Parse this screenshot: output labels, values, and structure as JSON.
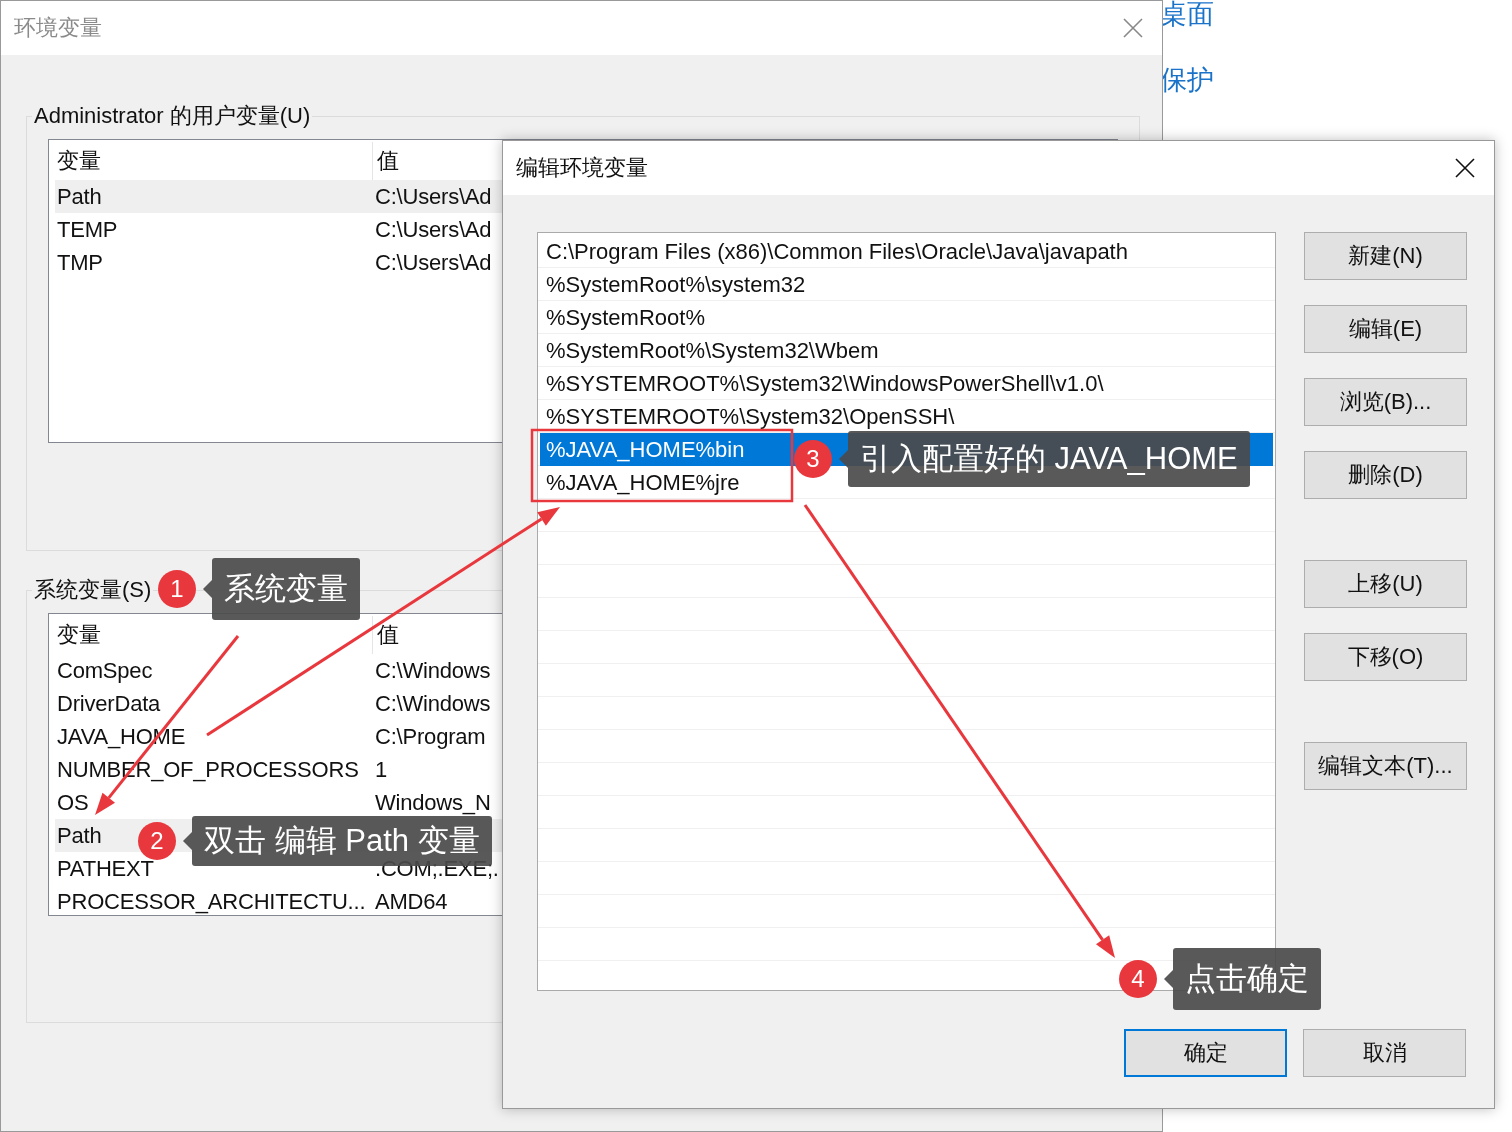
{
  "background_links": [
    "桌面",
    "保护"
  ],
  "env_window": {
    "title": "环境变量",
    "user_group": {
      "label": "Administrator 的用户变量(U)",
      "columns": [
        "变量",
        "值"
      ],
      "rows": [
        {
          "name": "Path",
          "value": "C:\\Users\\Ad",
          "selected": true
        },
        {
          "name": "TEMP",
          "value": "C:\\Users\\Ad",
          "selected": false
        },
        {
          "name": "TMP",
          "value": "C:\\Users\\Ad",
          "selected": false
        }
      ]
    },
    "system_group": {
      "label": "系统变量(S)",
      "columns": [
        "变量",
        "值"
      ],
      "rows": [
        {
          "name": "ComSpec",
          "value": "C:\\Windows",
          "selected": false
        },
        {
          "name": "DriverData",
          "value": "C:\\Windows",
          "selected": false
        },
        {
          "name": "JAVA_HOME",
          "value": "C:\\Program",
          "selected": false
        },
        {
          "name": "NUMBER_OF_PROCESSORS",
          "value": "1",
          "selected": false
        },
        {
          "name": "OS",
          "value": "Windows_N",
          "selected": false
        },
        {
          "name": "Path",
          "selected": true
        },
        {
          "name": "PATHEXT",
          "value": ".COM;.EXE;.",
          "selected": false
        },
        {
          "name": "PROCESSOR_ARCHITECTU...",
          "value": "AMD64",
          "selected": false
        }
      ]
    }
  },
  "edit_dialog": {
    "title": "编辑环境变量",
    "entries": [
      {
        "text": "C:\\Program Files (x86)\\Common Files\\Oracle\\Java\\javapath",
        "selected": false
      },
      {
        "text": "%SystemRoot%\\system32",
        "selected": false
      },
      {
        "text": "%SystemRoot%",
        "selected": false
      },
      {
        "text": "%SystemRoot%\\System32\\Wbem",
        "selected": false
      },
      {
        "text": "%SYSTEMROOT%\\System32\\WindowsPowerShell\\v1.0\\",
        "selected": false
      },
      {
        "text": "%SYSTEMROOT%\\System32\\OpenSSH\\",
        "selected": false
      },
      {
        "text": "%JAVA_HOME%bin",
        "selected": true
      },
      {
        "text": "%JAVA_HOME%jre",
        "selected": false
      }
    ],
    "button_groups": [
      [
        "新建(N)",
        "编辑(E)",
        "浏览(B)...",
        "删除(D)"
      ],
      [
        "上移(U)",
        "下移(O)"
      ],
      [
        "编辑文本(T)..."
      ]
    ],
    "footer_buttons": [
      {
        "label": "确定",
        "focused": true
      },
      {
        "label": "取消",
        "focused": false
      }
    ]
  },
  "annotations": [
    {
      "number": "1",
      "text": "系统变量"
    },
    {
      "number": "2",
      "text": "双击 编辑 Path 变量"
    },
    {
      "number": "3",
      "text": "引入配置好的 JAVA_HOME"
    },
    {
      "number": "4",
      "text": "点击确定"
    }
  ]
}
